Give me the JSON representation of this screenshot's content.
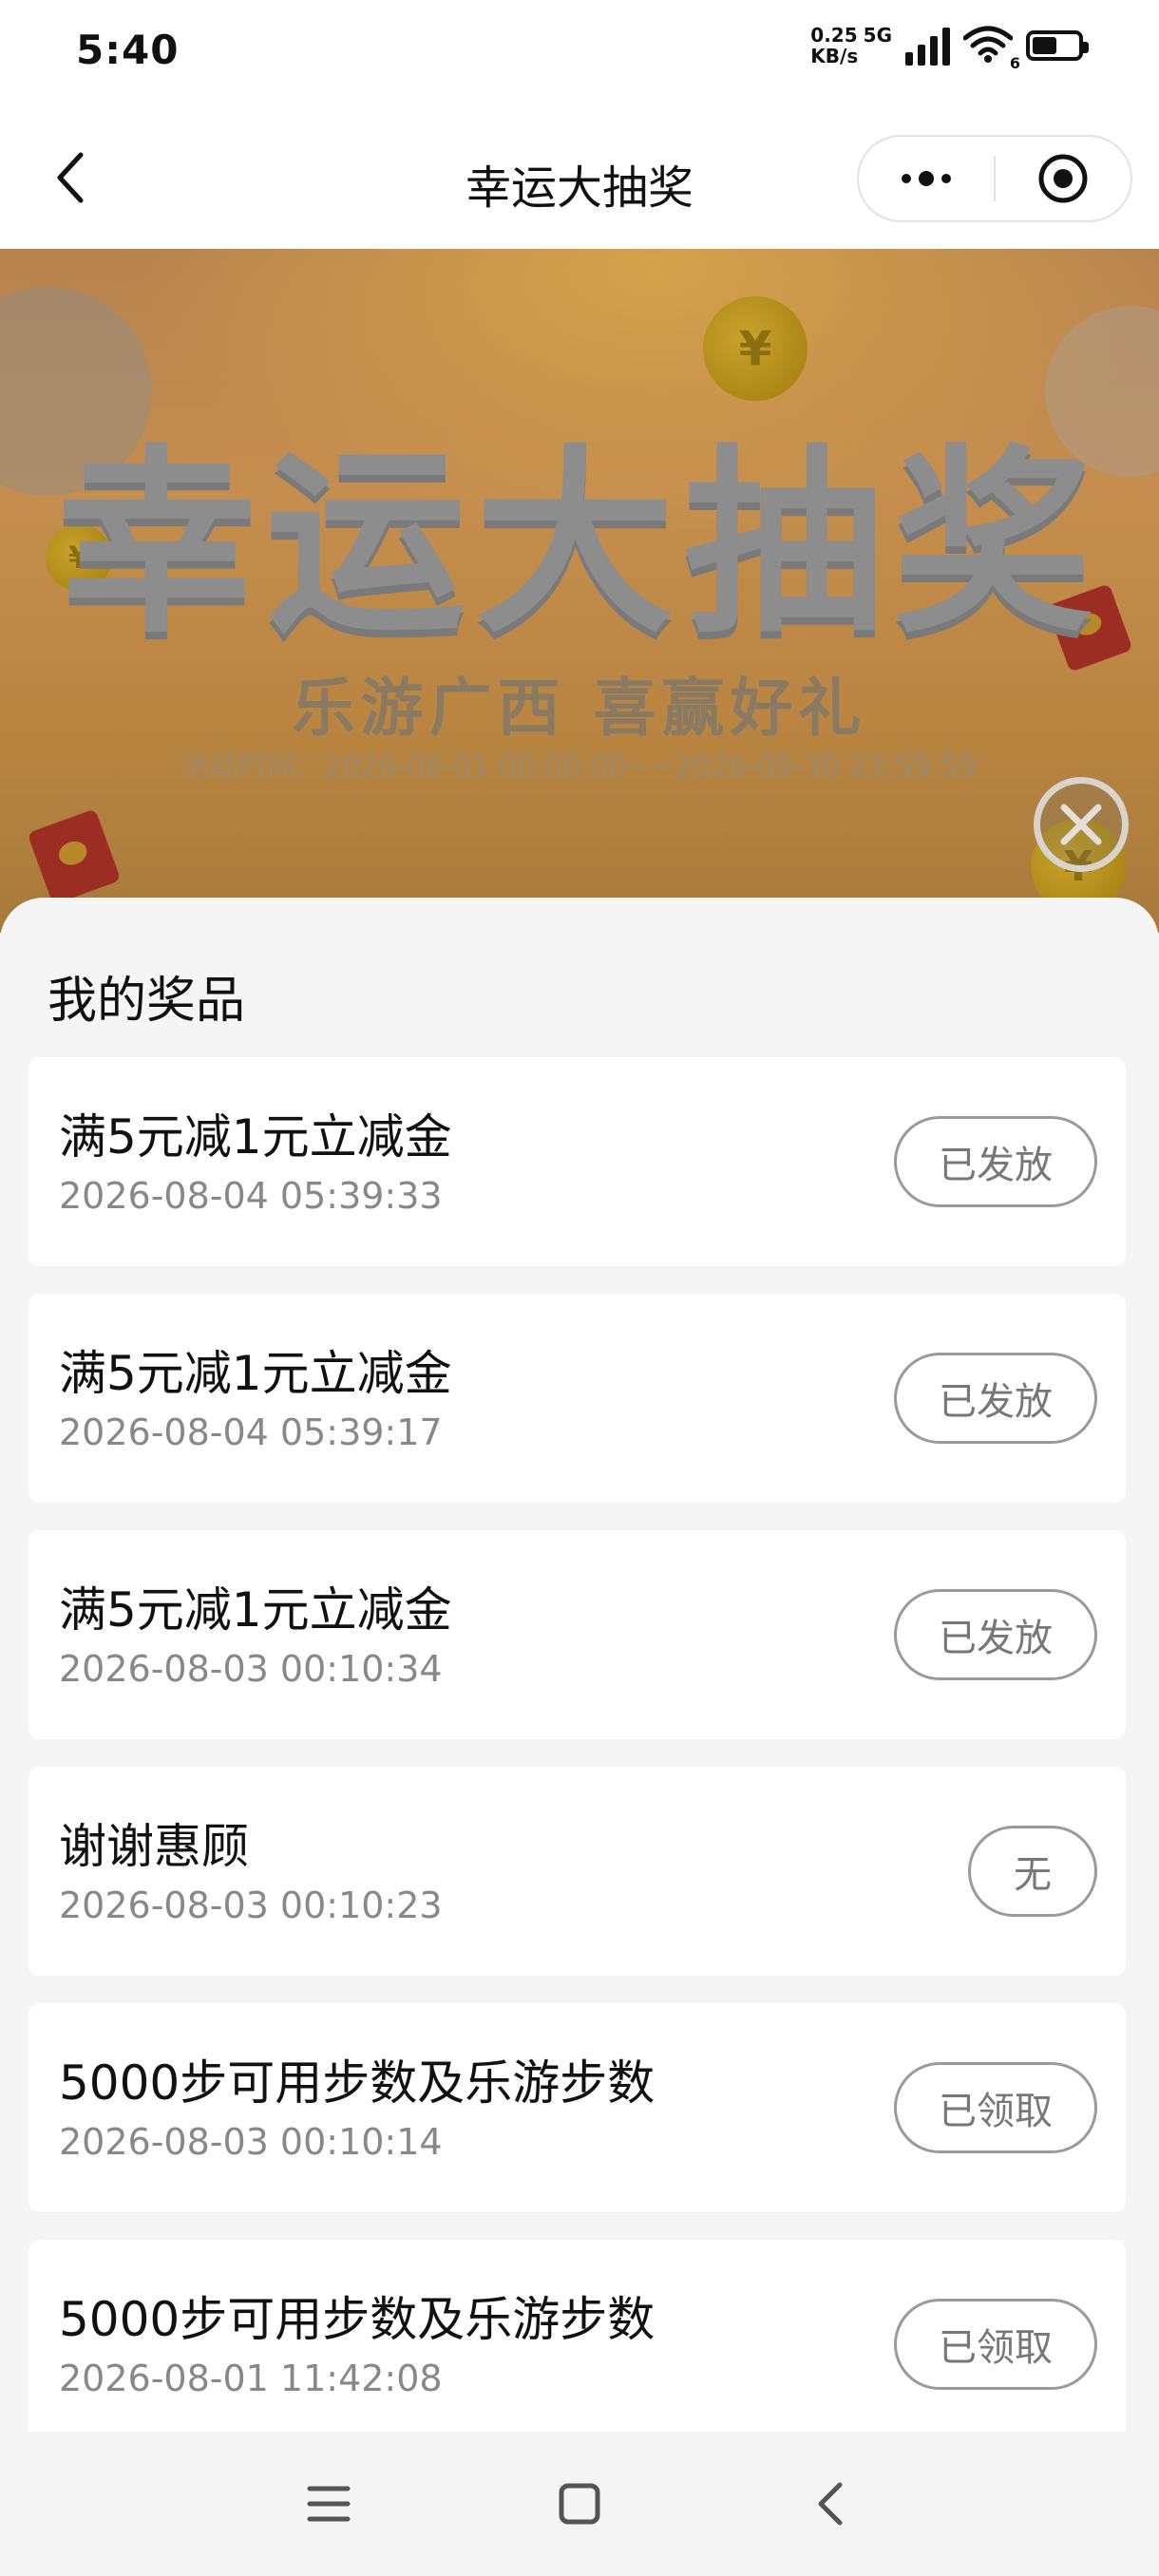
{
  "status_bar": {
    "time": "5:40",
    "net_speed_value": "0.25",
    "net_speed_unit": "KB/s",
    "network_type": "5G",
    "wifi_sub": "6",
    "battery_level": 0.6
  },
  "nav": {
    "title": "幸运大抽奖"
  },
  "banner": {
    "title": "幸运大抽奖",
    "subtitle": "乐游广西  喜赢好礼",
    "time_text": "活动时间：2026-08-01 00:00:00~~2026-09-30 23:59:59"
  },
  "sheet": {
    "title": "我的奖品",
    "prizes": [
      {
        "name": "满5元减1元立减金",
        "time": "2026-08-04 05:39:33",
        "status": "已发放"
      },
      {
        "name": "满5元减1元立减金",
        "time": "2026-08-04 05:39:17",
        "status": "已发放"
      },
      {
        "name": "满5元减1元立减金",
        "time": "2026-08-03 00:10:34",
        "status": "已发放"
      },
      {
        "name": "谢谢惠顾",
        "time": "2026-08-03 00:10:23",
        "status": "无"
      },
      {
        "name": "5000步可用步数及乐游步数",
        "time": "2026-08-03 00:10:14",
        "status": "已领取"
      },
      {
        "name": "5000步可用步数及乐游步数",
        "time": "2026-08-01 11:42:08",
        "status": "已领取"
      }
    ]
  },
  "icons": {
    "back": "chevron-left-icon",
    "more": "more-dots-icon",
    "target": "target-icon",
    "close": "close-circle-icon",
    "menu": "menu-icon",
    "home": "home-square-icon",
    "sys_back": "back-chevron-icon"
  }
}
